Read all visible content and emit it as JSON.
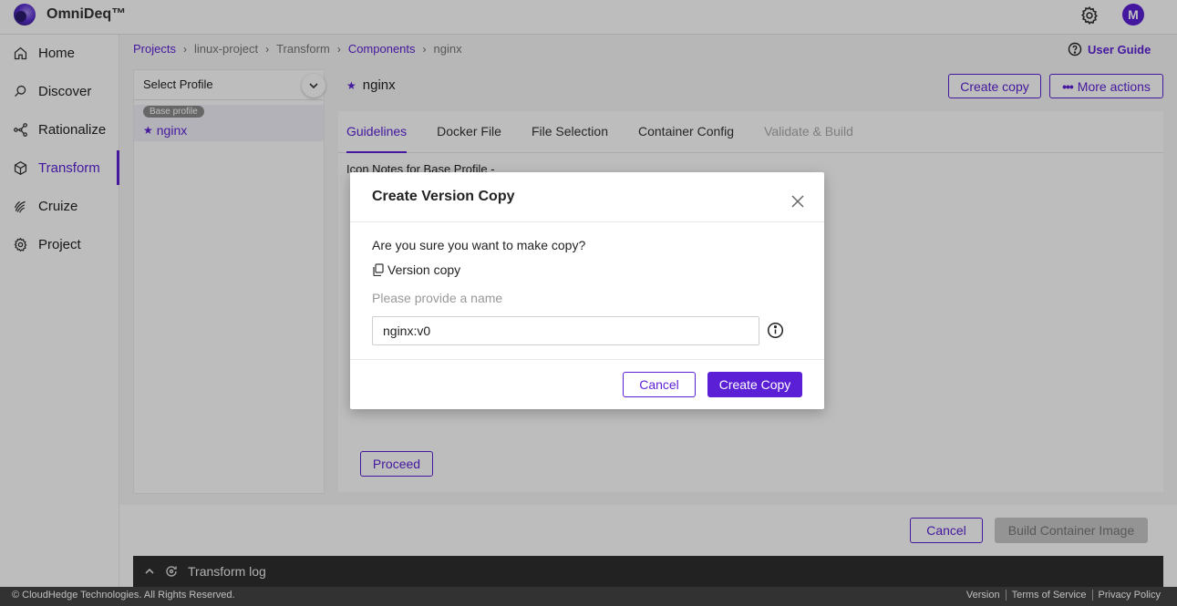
{
  "app": {
    "name": "OmniDeq™",
    "avatar_initial": "M",
    "accent_color": "#5b1fd6"
  },
  "sidebar": {
    "items": [
      {
        "label": "Home",
        "icon": "home-icon"
      },
      {
        "label": "Discover",
        "icon": "discover-icon"
      },
      {
        "label": "Rationalize",
        "icon": "rationalize-icon"
      },
      {
        "label": "Transform",
        "icon": "transform-icon",
        "active": true
      },
      {
        "label": "Cruize",
        "icon": "cruize-icon"
      },
      {
        "label": "Project",
        "icon": "project-gear-icon"
      }
    ]
  },
  "breadcrumb": [
    "Projects",
    "linux-project",
    "Transform",
    "Components",
    "nginx"
  ],
  "user_guide": "User Guide",
  "profile": {
    "select_label": "Select Profile",
    "badge": "Base profile",
    "name": "nginx"
  },
  "component": {
    "title": "nginx",
    "create_copy": "Create copy",
    "more_actions": "More actions"
  },
  "tabs": [
    "Guidelines",
    "Docker File",
    "File Selection",
    "Container Config",
    "Validate & Build"
  ],
  "notes_text": "Icon Notes for Base Profile -",
  "proceed": "Proceed",
  "bottom": {
    "cancel": "Cancel",
    "build": "Build Container Image"
  },
  "log": {
    "label": "Transform log"
  },
  "footer": {
    "copyright": "© CloudHedge Technologies. All Rights Reserved.",
    "links": [
      "Version",
      "Terms of Service",
      "Privacy Policy"
    ]
  },
  "modal": {
    "title": "Create Version Copy",
    "question": "Are you sure you want to make copy?",
    "copy_type": "Version copy",
    "hint": "Please provide a name",
    "name_value": "nginx:v0",
    "cancel": "Cancel",
    "confirm": "Create Copy"
  }
}
